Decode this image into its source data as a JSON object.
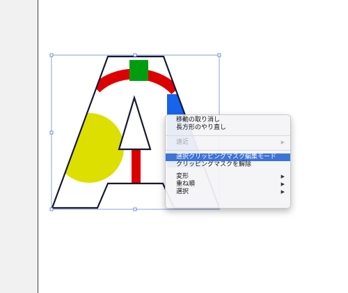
{
  "canvas": {
    "artwork_letter": "A",
    "colors": {
      "letter_outline": "#141833",
      "yellow": "#dddf00",
      "red": "#dd0000",
      "green": "#009e0f",
      "blue": "#1763ee",
      "selection": "#4a78d0"
    }
  },
  "context_menu": {
    "items": [
      {
        "label": "移動の取り消し",
        "enabled": true
      },
      {
        "label": "長方形のやり直し",
        "enabled": true
      },
      {
        "label": "遠近",
        "enabled": false,
        "submenu": true
      },
      {
        "label": "選択クリッピングマスク編集モード",
        "enabled": true,
        "highlighted": true
      },
      {
        "label": "クリッピングマスクを解除",
        "enabled": true
      },
      {
        "label": "変形",
        "enabled": true,
        "submenu": true
      },
      {
        "label": "重ね順",
        "enabled": true,
        "submenu": true
      },
      {
        "label": "選択",
        "enabled": true,
        "submenu": true
      }
    ],
    "submenu_arrow": "▶"
  }
}
